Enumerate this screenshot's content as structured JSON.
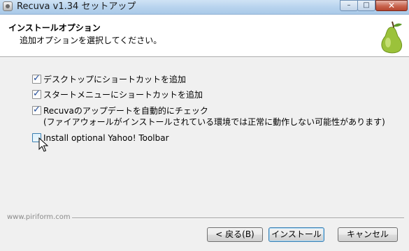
{
  "window": {
    "title": "Recuva v1.34 セットアップ",
    "controls": {
      "minimize": "–",
      "maximize": "□",
      "close": "✕"
    }
  },
  "header": {
    "title": "インストールオプション",
    "subtitle": "追加オプションを選択してください。"
  },
  "options": [
    {
      "label": "デスクトップにショートカットを追加",
      "checked": true
    },
    {
      "label": "スタートメニューにショートカットを追加",
      "checked": true
    },
    {
      "label": "Recuvaのアップデートを自動的にチェック",
      "note": "(ファイアウォールがインストールされている環境では正常に動作しない可能性があります)",
      "checked": true
    },
    {
      "label": "Install optional Yahoo! Toolbar",
      "checked": false
    }
  ],
  "footer": {
    "brand": "www.piriform.com",
    "buttons": {
      "back": "< 戻る(B)",
      "install": "インストール",
      "cancel": "キャンセル"
    }
  },
  "colors": {
    "accent": "#3c7fb1",
    "pear": "#9bc23a"
  }
}
